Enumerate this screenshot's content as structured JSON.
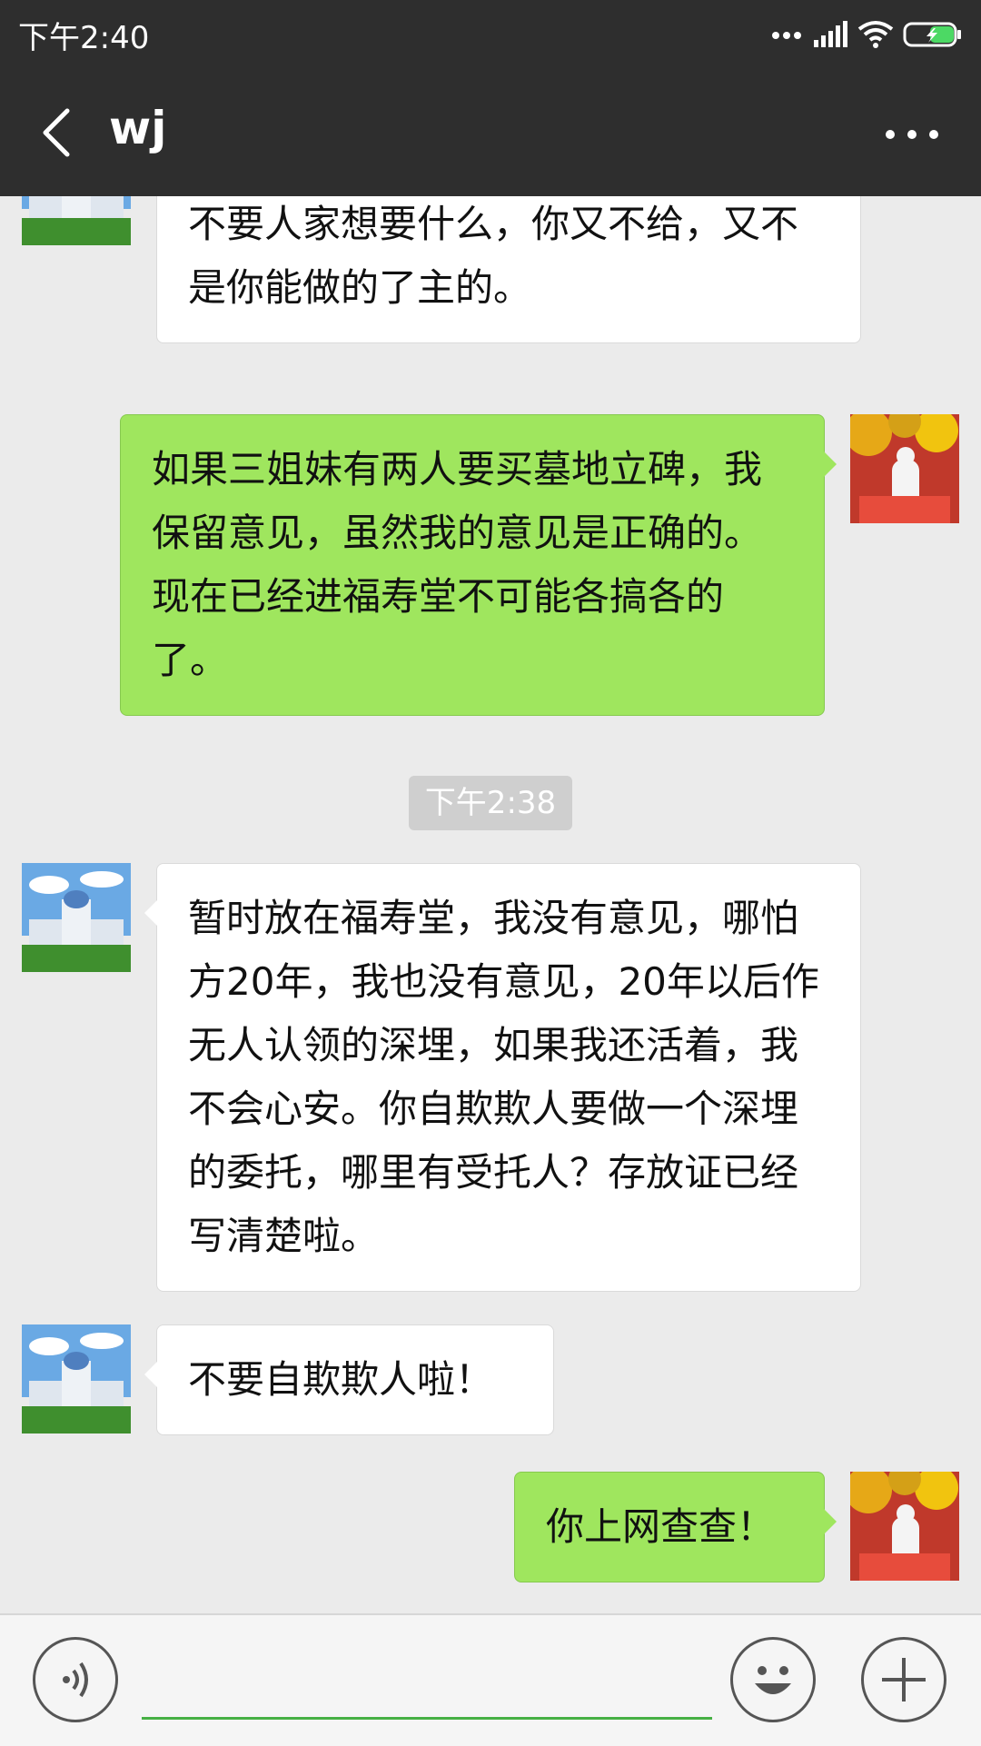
{
  "status_bar": {
    "time": "下午2:40"
  },
  "nav": {
    "title": "wj"
  },
  "messages": [
    {
      "side": "left",
      "text": "自己想要什么，就能要的到就好了，不要人家想要什么，你又不给，又不是你能做的了主的。"
    },
    {
      "side": "right",
      "text": "如果三姐妹有两人要买墓地立碑，我保留意见，虽然我的意见是正确的。现在已经进福寿堂不可能各搞各的了。"
    },
    {
      "side": "left",
      "text": "暂时放在福寿堂，我没有意见，哪怕方20年，我也没有意见，20年以后作无人认领的深埋，如果我还活着，我不会心安。你自欺欺人要做一个深埋的委托，哪里有受托人？存放证已经写清楚啦。"
    },
    {
      "side": "left",
      "text": "不要自欺欺人啦！"
    },
    {
      "side": "right",
      "text": "你上网查查！"
    }
  ],
  "timestamp": "下午2:38",
  "input": {
    "value": ""
  },
  "colors": {
    "bar": "#2e2e2e",
    "chat_bg": "#ebebeb",
    "sent_bubble": "#9fe65e",
    "received_bubble": "#ffffff",
    "input_underline": "#46b044"
  },
  "icons": [
    "back-icon",
    "more-icon",
    "voice-icon",
    "emoji-icon",
    "plus-icon",
    "signal-icon",
    "wifi-icon",
    "battery-icon"
  ]
}
